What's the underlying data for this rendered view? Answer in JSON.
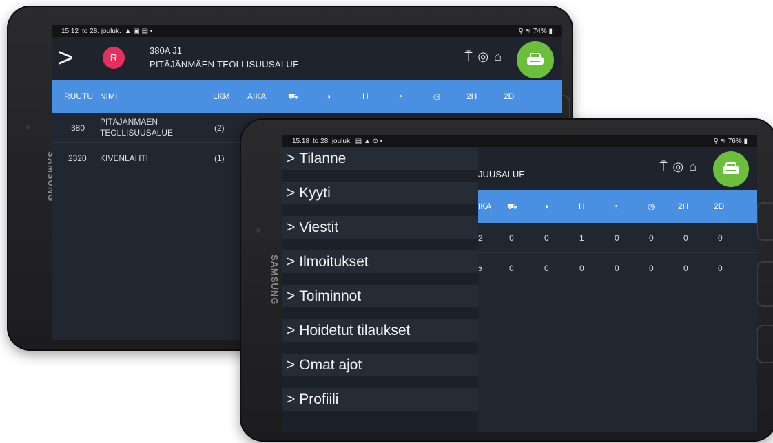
{
  "back_device": {
    "status": {
      "time": "15.12",
      "date": "to 28. jouluk.",
      "icons_left": "▲ ▣ ▤ •",
      "icons_right": "⚲ ≋ 74% ▮"
    },
    "header": {
      "menu_arrow": ">",
      "avatar_letter": "R",
      "line1": "380A J1",
      "line2": "PITÄJÄNMÄEN TEOLLISUUSALUE"
    },
    "table": {
      "columns": [
        "RUUTU",
        "NIMI",
        "LKM",
        "AIKA",
        "⛟",
        "◑",
        "H",
        "◔",
        "◷",
        "2H",
        "2D"
      ],
      "rows": [
        {
          "ruutu": "380",
          "nimi1": "PITÄJÄNMÄEN",
          "nimi2": "TEOLLISUUSALUE",
          "lkm": "(2)"
        },
        {
          "ruutu": "2320",
          "nimi1": "KIVENLAHTI",
          "nimi2": "",
          "lkm": "(1)"
        }
      ]
    },
    "brand": "SAMSUNG"
  },
  "front_device": {
    "status": {
      "time": "15.18",
      "date": "to 28. jouluk.",
      "icons_left": "▤ ▲ ⊙ •",
      "icons_right": "⚲ ≋ 76% ▮"
    },
    "header": {
      "line2_partial": "JUUSALUE"
    },
    "table": {
      "columns": [
        "IKA",
        "⛟",
        "◑",
        "H",
        "◔",
        "◷",
        "2H",
        "2D"
      ],
      "rows": [
        [
          "2",
          "0",
          "0",
          "1",
          "0",
          "0",
          "0",
          "0"
        ],
        [
          "э",
          "0",
          "0",
          "0",
          "0",
          "0",
          "0",
          "0"
        ]
      ]
    },
    "menu": [
      {
        "label": "Tilanne"
      },
      {
        "label": "Kyyti"
      },
      {
        "label": "Viestit"
      },
      {
        "label": "Ilmoitukset"
      },
      {
        "label": "Toiminnot"
      },
      {
        "label": "Hoidetut tilaukset"
      },
      {
        "label": "Omat ajot"
      },
      {
        "label": "Profiili"
      }
    ],
    "menu_chevron": ">",
    "brand": "SAMSUNG"
  },
  "icons": [
    "signal-tower-icon",
    "gps-target-icon",
    "router-icon",
    "car-icon"
  ]
}
